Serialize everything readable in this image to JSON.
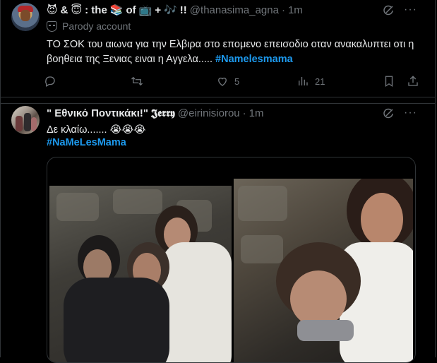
{
  "tweet1": {
    "name_parts": [
      "&",
      ": the",
      "of",
      "+",
      "!!"
    ],
    "handle": "@thanasima_agna",
    "dot": "·",
    "time": "1m",
    "parody_label": "Parody account",
    "text": "ΤΟ ΣΟΚ του αιωνα για την Ελβιρα στο επομενο επεισοδιο οταν ανακαλυπτει οτι η βοηθεια της Ξενιας ειναι η Αγγελα..... ",
    "hashtag": "#Namelesmama",
    "actions": {
      "reply_count": "",
      "retweet_count": "",
      "like_count": "5",
      "views_count": "21"
    }
  },
  "tweet2": {
    "name": "\" Εθνικό Ποντικάκι!\"",
    "name_suffix": "𝕵𝖊𝖗𝖗𝖞",
    "handle": "@eirinisiorou",
    "dot": "·",
    "time": "1m",
    "text": "Δε κλαίω....... 😭😭😭",
    "hashtag": "#NaMeLesMama"
  },
  "icons": {
    "grok": "grok-icon",
    "more": "more-icon",
    "reply": "reply-icon",
    "retweet": "retweet-icon",
    "like": "heart-icon",
    "views": "analytics-icon",
    "bookmark": "bookmark-icon",
    "share": "share-icon"
  },
  "colors": {
    "accent": "#1d9bf0",
    "muted": "#71767b",
    "text": "#e7e9ea",
    "background": "#000000",
    "border": "#2f3336"
  }
}
